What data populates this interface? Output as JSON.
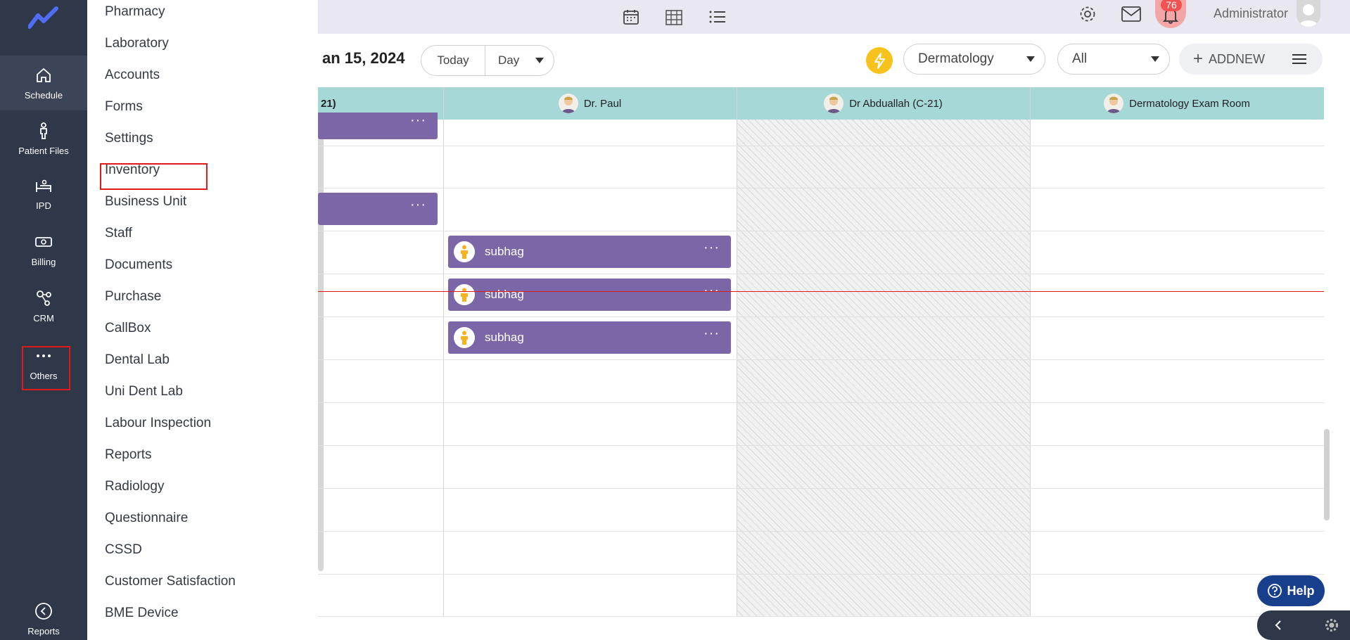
{
  "sidebar": {
    "items": [
      {
        "label": "Schedule",
        "icon": "home-icon"
      },
      {
        "label": "Patient Files",
        "icon": "person-icon"
      },
      {
        "label": "IPD",
        "icon": "bed-icon"
      },
      {
        "label": "Billing",
        "icon": "cash-icon"
      },
      {
        "label": "CRM",
        "icon": "crm-icon"
      },
      {
        "label": "Others",
        "icon": "more-dots-icon"
      }
    ],
    "bottom": {
      "label": "Reports",
      "icon": "back-circle-icon"
    }
  },
  "menu": {
    "items": [
      "Pharmacy",
      "Laboratory",
      "Accounts",
      "Forms",
      "Settings",
      "Inventory",
      "Business Unit",
      "Staff",
      "Documents",
      "Purchase",
      "CallBox",
      "Dental Lab",
      "Uni Dent Lab",
      "Labour Inspection",
      "Reports",
      "Radiology",
      "Questionnaire",
      "CSSD",
      "Customer Satisfaction",
      "BME Device"
    ]
  },
  "header": {
    "notification_count": "76",
    "user_name": "Administrator"
  },
  "toolbar": {
    "date_title": "an 15, 2024",
    "today_label": "Today",
    "view_label": "Day",
    "department": "Dermatology",
    "filter": "All",
    "add_label": "ADDNEW"
  },
  "calendar": {
    "columns": [
      "21)",
      "Dr. Paul",
      "Dr Abduallah (C-21)",
      "Dermatology Exam Room"
    ],
    "appointments": [
      {
        "name": "subhag"
      },
      {
        "name": "subhag"
      },
      {
        "name": "subhag"
      }
    ]
  },
  "help_label": "Help",
  "colors": {
    "sidebar": "#2e3849",
    "appointment": "#7b66a8",
    "header": "#a6d8d8",
    "highlight": "#e01a1a",
    "help": "#173f8c"
  }
}
